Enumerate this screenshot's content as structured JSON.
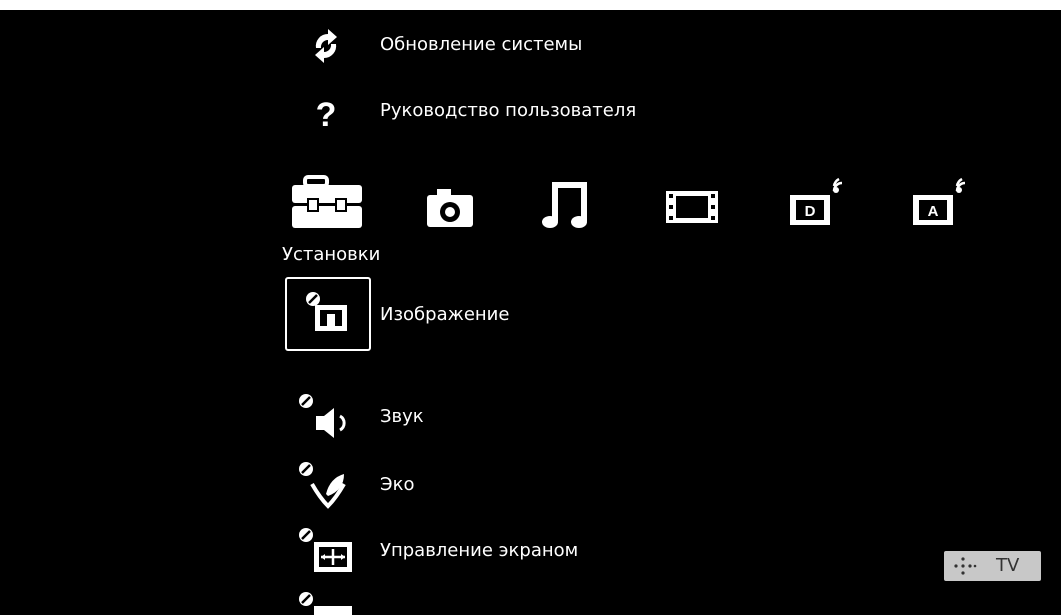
{
  "top_menu": [
    {
      "label": "Обновление системы",
      "icon": "refresh-icon"
    },
    {
      "label": "Руководство пользователя",
      "icon": "question-icon"
    }
  ],
  "categories": [
    {
      "icon": "toolbox-icon",
      "label": "Установки",
      "selected": true
    },
    {
      "icon": "camera-icon"
    },
    {
      "icon": "music-icon"
    },
    {
      "icon": "film-icon"
    },
    {
      "icon": "digital-broadcast-icon",
      "badge": "D"
    },
    {
      "icon": "analog-broadcast-icon",
      "badge": "A"
    }
  ],
  "settings_items": [
    {
      "label": "Изображение",
      "icon": "picture-settings-icon",
      "selected": true
    },
    {
      "label": "Звук",
      "icon": "sound-settings-icon"
    },
    {
      "label": "Эко",
      "icon": "eco-settings-icon"
    },
    {
      "label": "Управление экраном",
      "icon": "screen-control-icon"
    }
  ],
  "tv_badge": {
    "label": "TV"
  },
  "colors": {
    "background": "#000000",
    "text": "#ffffff",
    "badge_bg": "#c8c8c8"
  }
}
